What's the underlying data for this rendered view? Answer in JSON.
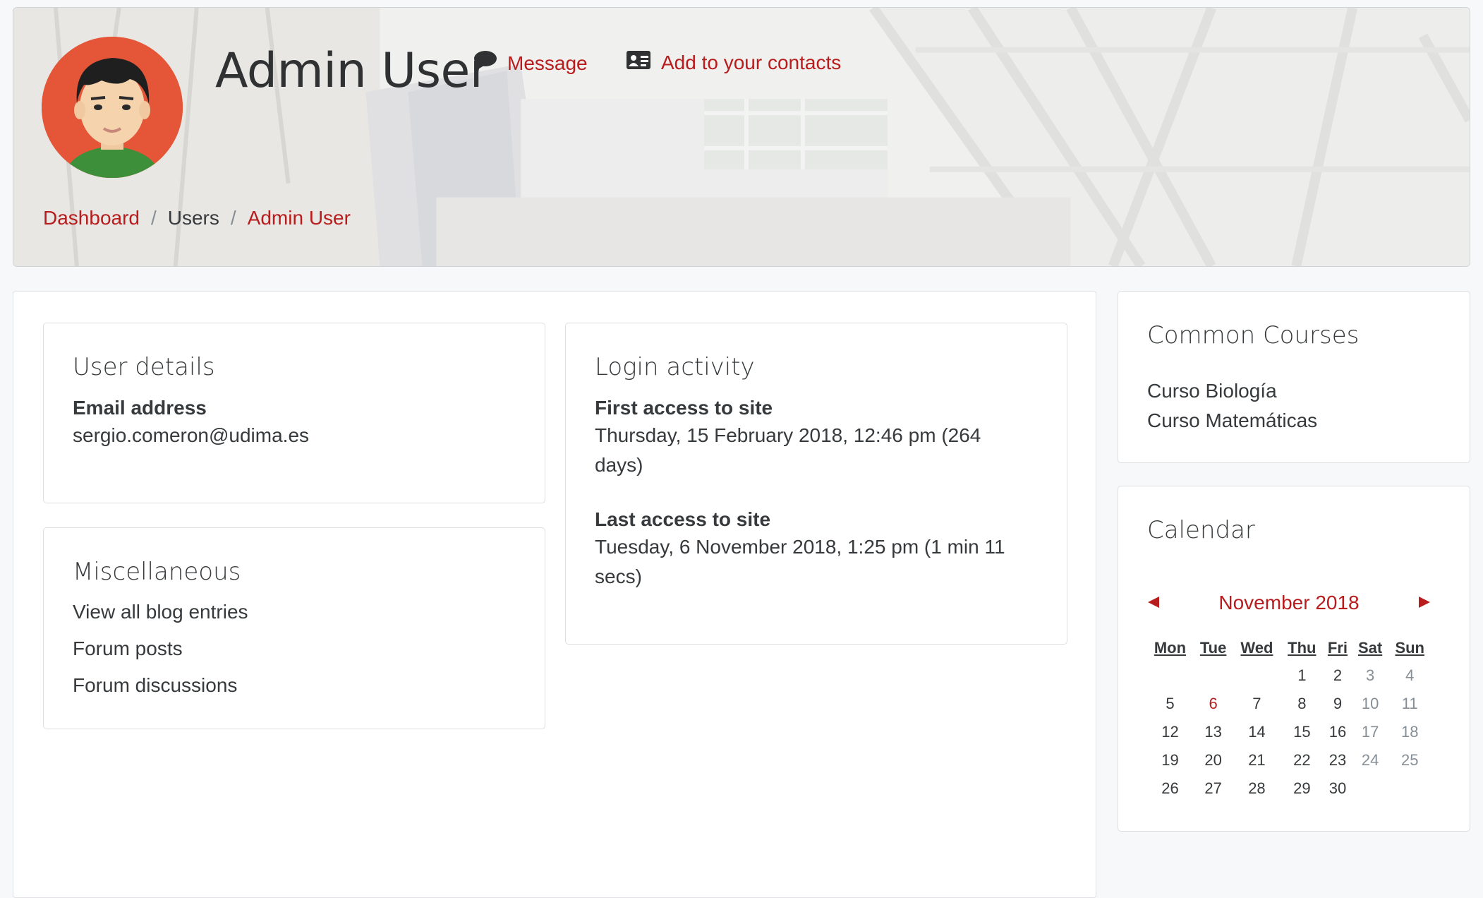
{
  "header": {
    "title": "Admin User",
    "message_label": "Message",
    "add_contact_label": "Add to your contacts",
    "breadcrumb": [
      "Dashboard",
      "Users",
      "Admin User"
    ]
  },
  "user_details": {
    "heading": "User details",
    "email_label": "Email address",
    "email_value": "sergio.comeron@udima.es"
  },
  "misc": {
    "heading": "Miscellaneous",
    "links": [
      "View all blog entries",
      "Forum posts",
      "Forum discussions"
    ]
  },
  "login": {
    "heading": "Login activity",
    "first_label": "First access to site",
    "first_value_line1": "Thursday, 15 February 2018, 12:46 pm  (264",
    "first_value_line2": "days)",
    "last_label": "Last access to site",
    "last_value_line1": "Tuesday, 6 November 2018, 1:25 pm  (1 min 11",
    "last_value_line2": "secs)"
  },
  "courses": {
    "heading": "Common Courses",
    "items": [
      "Curso Biología",
      "Curso Matemáticas"
    ]
  },
  "calendar": {
    "heading": "Calendar",
    "month": "November 2018",
    "days": [
      "Mon",
      "Tue",
      "Wed",
      "Thu",
      "Fri",
      "Sat",
      "Sun"
    ],
    "weeks": [
      [
        "",
        "",
        "",
        "1",
        "2",
        "3",
        "4"
      ],
      [
        "5",
        "6",
        "7",
        "8",
        "9",
        "10",
        "11"
      ],
      [
        "12",
        "13",
        "14",
        "15",
        "16",
        "17",
        "18"
      ],
      [
        "19",
        "20",
        "21",
        "22",
        "23",
        "24",
        "25"
      ],
      [
        "26",
        "27",
        "28",
        "29",
        "30",
        "",
        ""
      ]
    ],
    "today": "6"
  },
  "colors": {
    "link": "#b81c1c",
    "avatar_bg": "#e55538"
  },
  "icons": [
    "comment-icon",
    "address-card-icon",
    "prev-month-icon",
    "next-month-icon"
  ]
}
